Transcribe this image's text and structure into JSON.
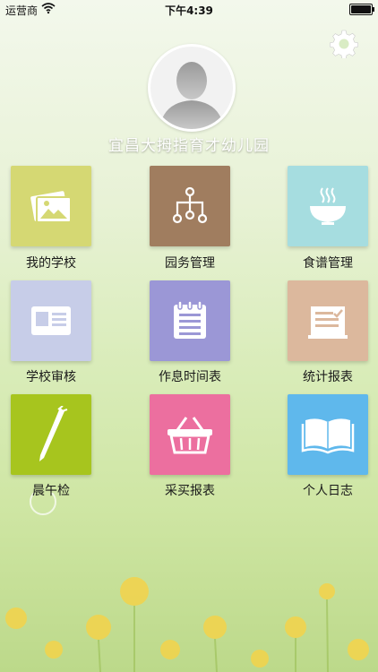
{
  "status_bar": {
    "carrier": "运营商",
    "time": "下午4:39"
  },
  "header": {
    "school_name": "宜昌大拇指育才幼儿园"
  },
  "icons": {
    "settings": "gear-icon",
    "avatar": "person-silhouette-icon"
  },
  "tiles": [
    {
      "label": "我的学校",
      "color": "#d5d873",
      "icon": "photo-frame-icon"
    },
    {
      "label": "园务管理",
      "color": "#a07d5f",
      "icon": "org-tree-icon"
    },
    {
      "label": "食谱管理",
      "color": "#a6dde0",
      "icon": "bowl-icon"
    },
    {
      "label": "学校审核",
      "color": "#c7cde8",
      "icon": "id-card-icon"
    },
    {
      "label": "作息时间表",
      "color": "#9b97d6",
      "icon": "notepad-icon"
    },
    {
      "label": "统计报表",
      "color": "#dcb89d",
      "icon": "checklist-icon"
    },
    {
      "label": "晨午检",
      "color": "#a7c51e",
      "icon": "thermometer-icon"
    },
    {
      "label": "采买报表",
      "color": "#ec6f9f",
      "icon": "basket-icon"
    },
    {
      "label": "个人日志",
      "color": "#5fb8ec",
      "icon": "book-icon"
    }
  ]
}
